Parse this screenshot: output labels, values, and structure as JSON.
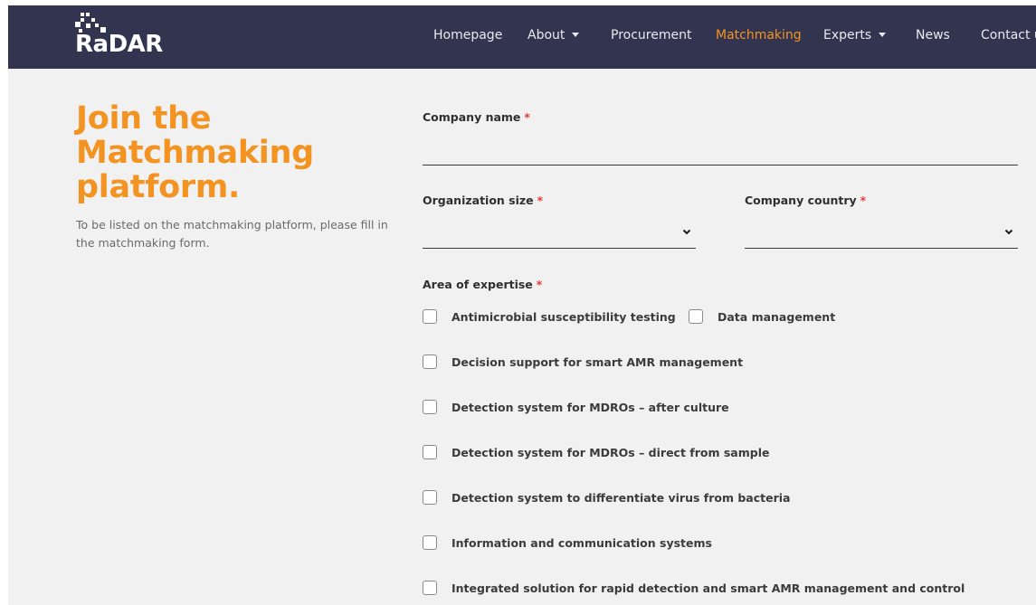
{
  "brand": {
    "logo_text": "RaDAR"
  },
  "nav": {
    "items": [
      {
        "label": "Homepage",
        "has_dropdown": false,
        "active": false
      },
      {
        "label": "About",
        "has_dropdown": true,
        "active": false
      },
      {
        "label": "Procurement",
        "has_dropdown": false,
        "active": false
      },
      {
        "label": "Matchmaking",
        "has_dropdown": false,
        "active": true
      },
      {
        "label": "Experts",
        "has_dropdown": true,
        "active": false
      },
      {
        "label": "News",
        "has_dropdown": false,
        "active": false
      },
      {
        "label": "Contact u",
        "has_dropdown": false,
        "active": false
      }
    ]
  },
  "hero": {
    "title_line1": "Join the",
    "title_line2": "Matchmaking",
    "title_line3": "platform.",
    "description": "To be listed on the matchmaking platform, please fill in the matchmaking form."
  },
  "form": {
    "required_mark": "*",
    "company_name": {
      "label": "Company name",
      "value": ""
    },
    "organization_size": {
      "label": "Organization size",
      "value": ""
    },
    "company_country": {
      "label": "Company country",
      "value": ""
    },
    "area_of_expertise": {
      "label": "Area of expertise",
      "options": [
        {
          "label": "Antimicrobial susceptibility testing",
          "checked": false
        },
        {
          "label": "Data management",
          "checked": false
        },
        {
          "label": "Decision support for smart AMR management",
          "checked": false
        },
        {
          "label": "Detection system for MDROs – after culture",
          "checked": false
        },
        {
          "label": "Detection system for MDROs – direct from sample",
          "checked": false
        },
        {
          "label": "Detection system to differentiate virus from bacteria",
          "checked": false
        },
        {
          "label": "Information and communication systems",
          "checked": false
        },
        {
          "label": "Integrated solution for rapid detection and smart AMR management and control",
          "checked": false
        }
      ]
    }
  },
  "colors": {
    "nav_bg": "#33344f",
    "accent": "#f39422",
    "page_bg": "#f1f1f1",
    "required": "#e53935"
  }
}
